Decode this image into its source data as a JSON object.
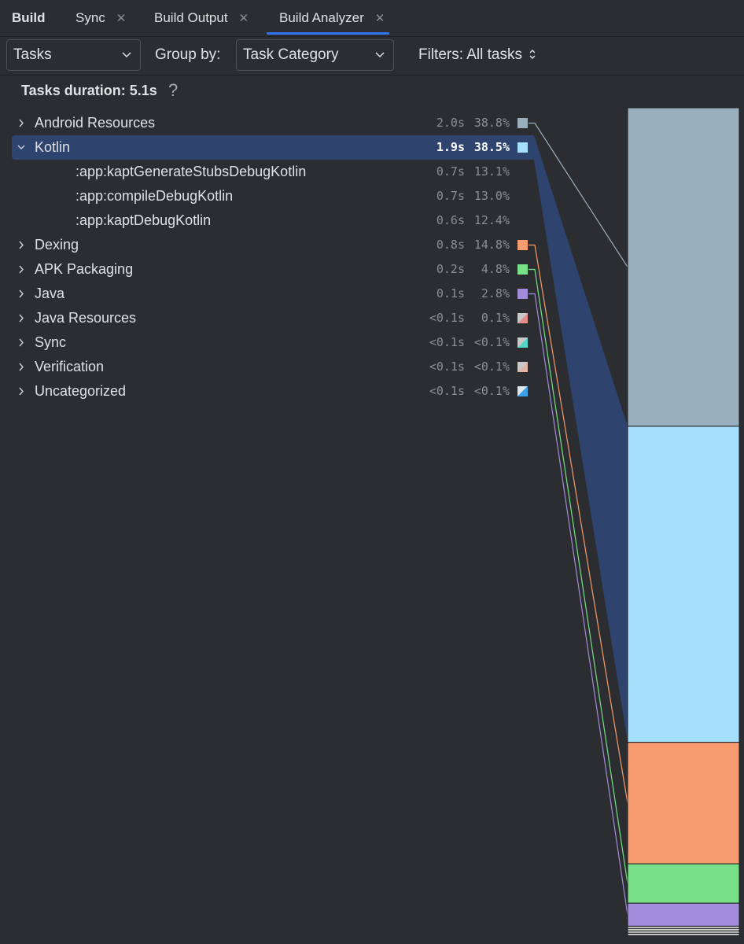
{
  "tabs": [
    {
      "label": "Build",
      "closable": false,
      "bold": true
    },
    {
      "label": "Sync",
      "closable": true
    },
    {
      "label": "Build Output",
      "closable": true
    },
    {
      "label": "Build Analyzer",
      "closable": true,
      "active": true
    }
  ],
  "toolbar": {
    "view_select": "Tasks",
    "group_by_label": "Group by:",
    "group_by_select": "Task Category",
    "filters_label": "Filters: All tasks"
  },
  "summary": {
    "title": "Tasks duration: 5.1s",
    "help_icon": "question-icon"
  },
  "rows": [
    {
      "name": "Android Resources",
      "duration": "2.0s",
      "percent": "38.8%",
      "color": "#9aafbd",
      "expandable": true,
      "expanded": false
    },
    {
      "name": "Kotlin",
      "duration": "1.9s",
      "percent": "38.5%",
      "color": "#a6e0fd",
      "expandable": true,
      "expanded": true,
      "selected": true
    },
    {
      "name": ":app:kaptGenerateStubsDebugKotlin",
      "duration": "0.7s",
      "percent": "13.1%",
      "child": true
    },
    {
      "name": ":app:compileDebugKotlin",
      "duration": "0.7s",
      "percent": "13.0%",
      "child": true
    },
    {
      "name": ":app:kaptDebugKotlin",
      "duration": "0.6s",
      "percent": "12.4%",
      "child": true
    },
    {
      "name": "Dexing",
      "duration": "0.8s",
      "percent": "14.8%",
      "color": "#f79c6e",
      "expandable": true,
      "expanded": false
    },
    {
      "name": "APK Packaging",
      "duration": "0.2s",
      "percent": "4.8%",
      "color": "#78e088",
      "expandable": true,
      "expanded": false
    },
    {
      "name": "Java",
      "duration": "0.1s",
      "percent": "2.8%",
      "color": "#a38cdb",
      "expandable": true,
      "expanded": false
    },
    {
      "name": "Java Resources",
      "duration": "<0.1s",
      "percent": "0.1%",
      "color": "#e88d8d",
      "color2": "#c9c9c9",
      "expandable": true,
      "expanded": false
    },
    {
      "name": "Sync",
      "duration": "<0.1s",
      "percent": "<0.1%",
      "color": "#4fd6c7",
      "color2": "#c9c9c9",
      "expandable": true,
      "expanded": false
    },
    {
      "name": "Verification",
      "duration": "<0.1s",
      "percent": "<0.1%",
      "color": "#e0b6a8",
      "color2": "#c9c9c9",
      "expandable": true,
      "expanded": false
    },
    {
      "name": "Uncategorized",
      "duration": "<0.1s",
      "percent": "<0.1%",
      "color": "#3aa2e8",
      "color2": "#dfe6ee",
      "expandable": true,
      "expanded": false
    }
  ],
  "chart_data": {
    "type": "bar",
    "orientation": "stacked-vertical",
    "categories": [
      "Android Resources",
      "Kotlin",
      "Dexing",
      "APK Packaging",
      "Java",
      "Java Resources",
      "Sync",
      "Verification",
      "Uncategorized"
    ],
    "values": [
      38.8,
      38.5,
      14.8,
      4.8,
      2.8,
      0.1,
      0.05,
      0.05,
      0.05
    ],
    "unit": "%",
    "colors": [
      "#9aafbd",
      "#a6e0fd",
      "#f79c6e",
      "#78e088",
      "#a38cdb",
      "#cfcfcf",
      "#cfcfcf",
      "#cfcfcf",
      "#cfcfcf"
    ],
    "selected": "Kotlin"
  }
}
